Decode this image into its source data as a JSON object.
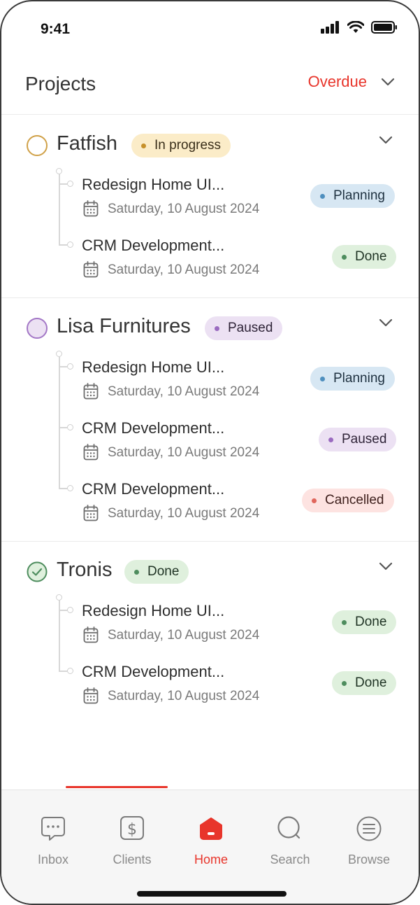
{
  "status_bar": {
    "time": "9:41"
  },
  "header": {
    "title": "Projects",
    "filter_label": "Overdue"
  },
  "colors": {
    "accent": "#e8352b",
    "in_progress_bg": "#fbecc8",
    "in_progress_dot": "#c6902a",
    "planning_bg": "#d7e7f3",
    "planning_dot": "#4f8fbe",
    "done_bg": "#dff0dd",
    "done_dot": "#4e8d5e",
    "paused_bg": "#ece1f3",
    "paused_dot": "#9a6bc0",
    "cancelled_bg": "#fde3e1",
    "cancelled_dot": "#e0665c"
  },
  "groups": [
    {
      "name": "Fatfish",
      "status": "In progress",
      "tasks": [
        {
          "name": "Redesign Home UI...",
          "date": "Saturday, 10 August 2024",
          "status": "Planning"
        },
        {
          "name": "CRM Development...",
          "date": "Saturday, 10 August 2024",
          "status": "Done"
        }
      ]
    },
    {
      "name": "Lisa Furnitures",
      "status": "Paused",
      "tasks": [
        {
          "name": "Redesign Home UI...",
          "date": "Saturday, 10 August 2024",
          "status": "Planning"
        },
        {
          "name": "CRM Development...",
          "date": "Saturday, 10 August 2024",
          "status": "Paused"
        },
        {
          "name": "CRM Development...",
          "date": "Saturday, 10 August 2024",
          "status": "Cancelled"
        }
      ]
    },
    {
      "name": "Tronis",
      "status": "Done",
      "tasks": [
        {
          "name": "Redesign Home UI...",
          "date": "Saturday, 10 August 2024",
          "status": "Done"
        },
        {
          "name": "CRM Development...",
          "date": "Saturday, 10 August 2024",
          "status": "Done"
        }
      ]
    }
  ],
  "nav": {
    "items": [
      {
        "label": "Inbox",
        "icon": "chat-bubble-icon"
      },
      {
        "label": "Clients",
        "icon": "dollar-icon"
      },
      {
        "label": "Home",
        "icon": "home-icon",
        "active": true
      },
      {
        "label": "Search",
        "icon": "search-icon"
      },
      {
        "label": "Browse",
        "icon": "list-icon"
      }
    ]
  }
}
